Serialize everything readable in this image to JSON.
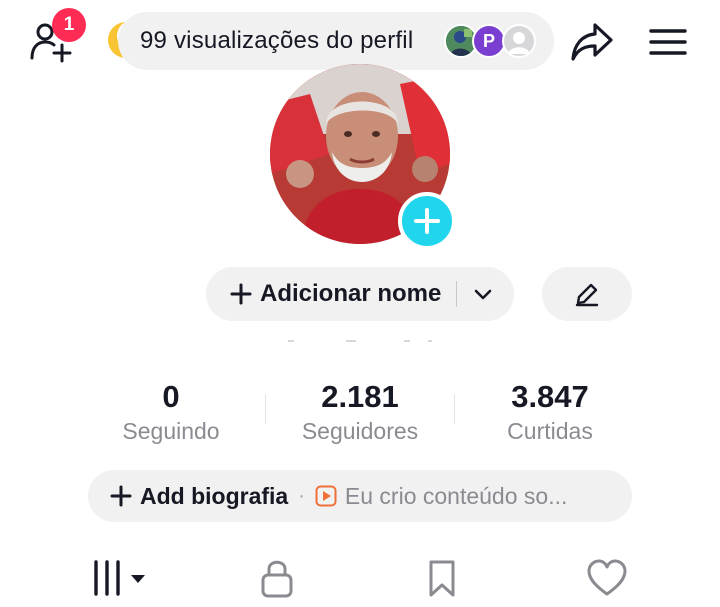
{
  "header": {
    "add_friends_badge": "1",
    "profile_views_text": "99 visualizações do perfil",
    "viewers": [
      {
        "type": "photo"
      },
      {
        "type": "initial",
        "letter": "P"
      },
      {
        "type": "default"
      }
    ]
  },
  "profile": {
    "add_name_label": "Adicionar nome"
  },
  "stats": [
    {
      "value": "0",
      "label": "Seguindo"
    },
    {
      "value": "2.181",
      "label": "Seguidores"
    },
    {
      "value": "3.847",
      "label": "Curtidas"
    }
  ],
  "bio": {
    "add_label": "Add biografia",
    "separator": "·",
    "suggestion": "Eu crio conteúdo so..."
  },
  "colors": {
    "badge": "#fe2c55",
    "avatar_add": "#20d5ec",
    "pill_bg": "#f1f1f2",
    "text_primary": "#161823",
    "text_secondary": "#8a8b91",
    "suggest_icon": "#f0703a"
  },
  "tabs": [
    {
      "icon": "videos-grid-icon",
      "selected": true
    },
    {
      "icon": "lock-icon"
    },
    {
      "icon": "bookmark-icon"
    },
    {
      "icon": "heart-icon"
    }
  ]
}
